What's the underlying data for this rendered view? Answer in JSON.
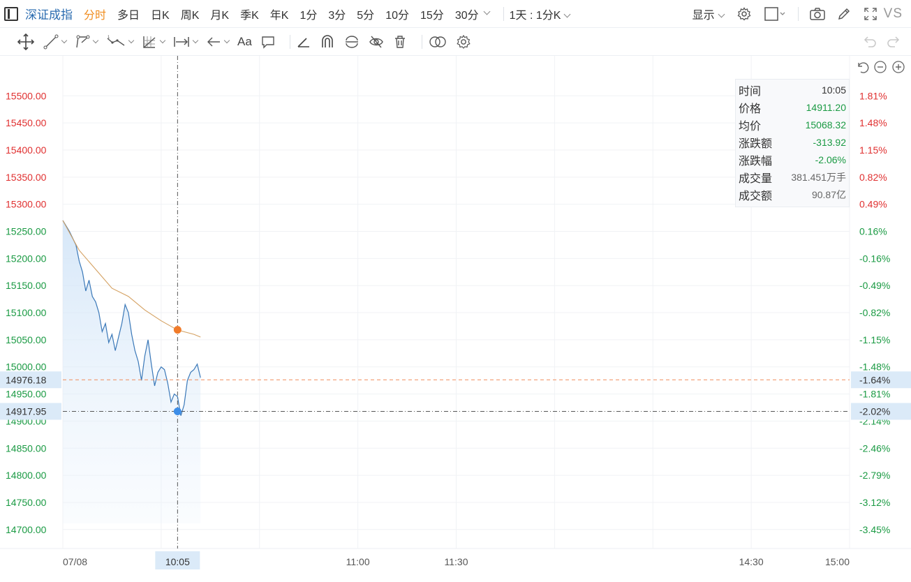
{
  "toolbar": {
    "symbol": "深证成指",
    "periods": [
      "分时",
      "多日",
      "日K",
      "周K",
      "月K",
      "季K",
      "年K",
      "1分",
      "3分",
      "5分",
      "10分",
      "15分",
      "30分"
    ],
    "active_period": "分时",
    "timeframe": "1天 : 1分K",
    "display": "显示",
    "vs": "VS"
  },
  "drawing_tools": {
    "font_button": "Aa"
  },
  "tooltip": {
    "rows": [
      {
        "label": "时间",
        "value": "10:05",
        "tone": "black"
      },
      {
        "label": "价格",
        "value": "14911.20",
        "tone": "green"
      },
      {
        "label": "均价",
        "value": "15068.32",
        "tone": "green"
      },
      {
        "label": "涨跌额",
        "value": "-313.92",
        "tone": "green"
      },
      {
        "label": "涨跌幅",
        "value": "-2.06%",
        "tone": "green"
      },
      {
        "label": "成交量",
        "value": "381.451万手",
        "tone": "grey"
      },
      {
        "label": "成交额",
        "value": "90.87亿",
        "tone": "grey"
      }
    ]
  },
  "colors": {
    "up": "#e03030",
    "down": "#1a9a43",
    "price_line": "#3a78b8",
    "avg_line": "#d4a060",
    "crosshair_dot": "#3d8ee8",
    "avg_dot": "#f07b2a",
    "last_price_line": "#f08c5a",
    "label_bg": "#dbeaf8"
  },
  "chart_data": {
    "type": "line",
    "price_ticks": [
      "15500.00",
      "15450.00",
      "15400.00",
      "15350.00",
      "15300.00",
      "15250.00",
      "15200.00",
      "15150.00",
      "15100.00",
      "15050.00",
      "15000.00",
      "14950.00",
      "14900.00",
      "14850.00",
      "14800.00",
      "14750.00",
      "14700.00"
    ],
    "price_tick_values": [
      15500,
      15450,
      15400,
      15350,
      15300,
      15250,
      15200,
      15150,
      15100,
      15050,
      15000,
      14950,
      14900,
      14850,
      14800,
      14750,
      14700
    ],
    "pct_ticks": [
      "1.81%",
      "1.48%",
      "1.15%",
      "0.82%",
      "0.49%",
      "0.16%",
      "-0.16%",
      "-0.49%",
      "-0.82%",
      "-1.15%",
      "-1.48%",
      "-1.81%",
      "-2.14%",
      "-2.46%",
      "-2.79%",
      "-3.12%",
      "-3.45%"
    ],
    "time_ticks": [
      {
        "label": "07/08",
        "minute": 0
      },
      {
        "label": "11:00",
        "minute": 90
      },
      {
        "label": "11:30",
        "minute": 120
      },
      {
        "label": "14:30",
        "minute": 210
      },
      {
        "label": "15:00",
        "minute": 240
      }
    ],
    "y_range": [
      14665,
      15530
    ],
    "x_range": [
      0,
      240
    ],
    "last_price_label": "14976.18",
    "last_price_pct": "-1.64%",
    "last_price": 14976.18,
    "cursor_price_label": "14917.95",
    "cursor_price_pct": "-2.02%",
    "cursor_price": 14917.95,
    "cursor_time_label": "10:05",
    "cursor_minute": 35,
    "cursor_avg": 15068.32,
    "series": [
      {
        "values": [
          {
            "m": 0,
            "v": 15270
          },
          {
            "m": 2,
            "v": 15250
          },
          {
            "m": 4,
            "v": 15225
          },
          {
            "m": 5,
            "v": 15195
          },
          {
            "m": 6,
            "v": 15175
          },
          {
            "m": 7,
            "v": 15140
          },
          {
            "m": 8,
            "v": 15160
          },
          {
            "m": 9,
            "v": 15130
          },
          {
            "m": 10,
            "v": 15120
          },
          {
            "m": 11,
            "v": 15100
          },
          {
            "m": 12,
            "v": 15065
          },
          {
            "m": 13,
            "v": 15080
          },
          {
            "m": 14,
            "v": 15045
          },
          {
            "m": 15,
            "v": 15060
          },
          {
            "m": 16,
            "v": 15030
          },
          {
            "m": 17,
            "v": 15055
          },
          {
            "m": 18,
            "v": 15080
          },
          {
            "m": 19,
            "v": 15115
          },
          {
            "m": 20,
            "v": 15100
          },
          {
            "m": 21,
            "v": 15060
          },
          {
            "m": 22,
            "v": 15030
          },
          {
            "m": 23,
            "v": 15010
          },
          {
            "m": 24,
            "v": 14975
          },
          {
            "m": 25,
            "v": 15020
          },
          {
            "m": 26,
            "v": 15050
          },
          {
            "m": 27,
            "v": 15005
          },
          {
            "m": 28,
            "v": 14965
          },
          {
            "m": 29,
            "v": 14990
          },
          {
            "m": 30,
            "v": 15000
          },
          {
            "m": 31,
            "v": 14995
          },
          {
            "m": 32,
            "v": 14970
          },
          {
            "m": 33,
            "v": 14935
          },
          {
            "m": 34,
            "v": 14950
          },
          {
            "m": 35,
            "v": 14945
          },
          {
            "m": 36,
            "v": 14910
          },
          {
            "m": 37,
            "v": 14930
          },
          {
            "m": 38,
            "v": 14975
          },
          {
            "m": 39,
            "v": 14990
          },
          {
            "m": 40,
            "v": 14995
          },
          {
            "m": 41,
            "v": 15005
          },
          {
            "m": 42,
            "v": 14980
          }
        ]
      },
      {
        "values": [
          {
            "m": 0,
            "v": 15270
          },
          {
            "m": 5,
            "v": 15215
          },
          {
            "m": 10,
            "v": 15180
          },
          {
            "m": 15,
            "v": 15145
          },
          {
            "m": 20,
            "v": 15130
          },
          {
            "m": 25,
            "v": 15105
          },
          {
            "m": 30,
            "v": 15085
          },
          {
            "m": 35,
            "v": 15068
          },
          {
            "m": 40,
            "v": 15060
          },
          {
            "m": 42,
            "v": 15055
          }
        ]
      }
    ]
  }
}
